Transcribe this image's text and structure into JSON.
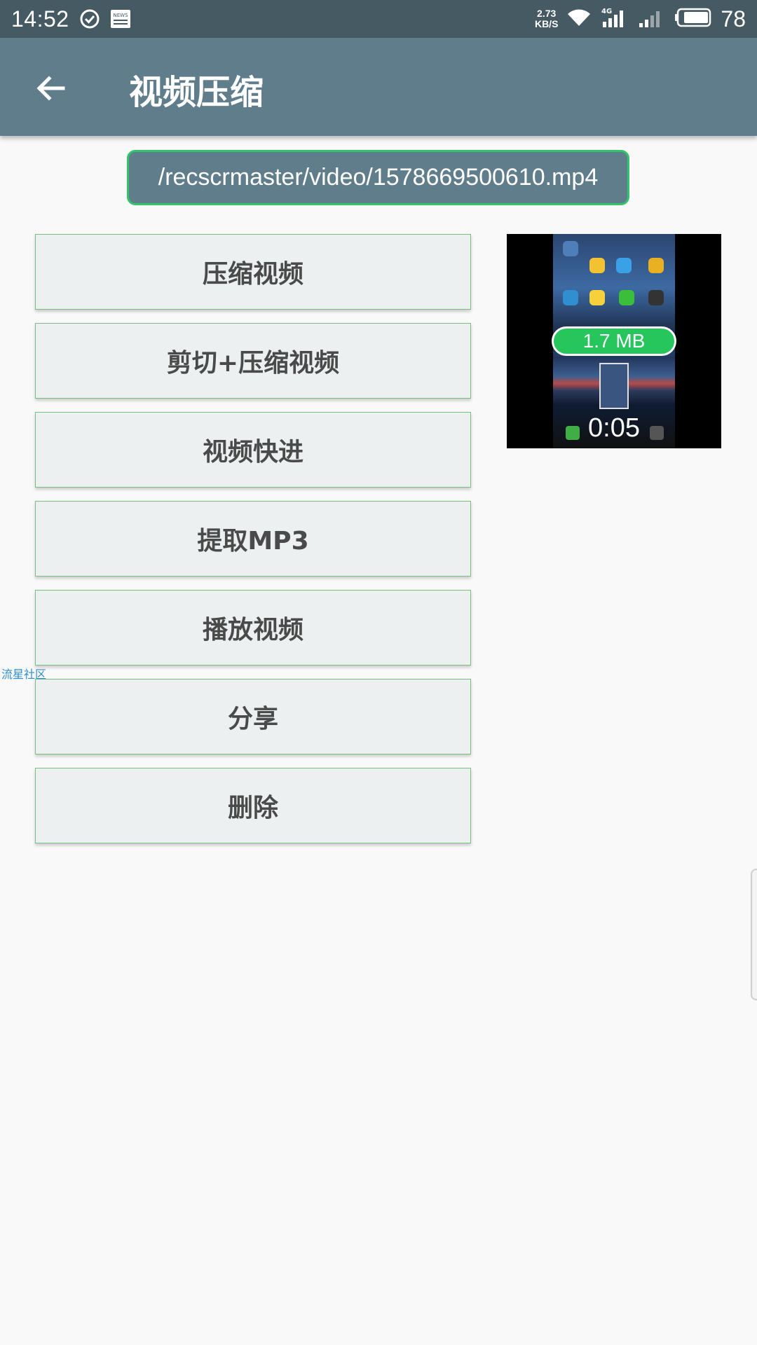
{
  "status_bar": {
    "time": "14:52",
    "net_speed_value": "2.73",
    "net_speed_unit": "KB/S",
    "network_type": "4G",
    "battery": "78",
    "news_icon_text": "NEWS"
  },
  "app_bar": {
    "title": "视频压缩",
    "back_icon": "arrow-back-icon"
  },
  "file_path": "/recscrmaster/video/1578669500610.mp4",
  "actions": [
    {
      "label": "压缩视频"
    },
    {
      "label": "剪切+压缩视频"
    },
    {
      "label": "视频快进"
    },
    {
      "label": "提取MP3"
    },
    {
      "label": "播放视频"
    },
    {
      "label": "分享"
    },
    {
      "label": "删除"
    }
  ],
  "thumbnail": {
    "size": "1.7 MB",
    "duration": "0:05"
  },
  "watermark": "流星社区",
  "colors": {
    "status_bar": "#465a64",
    "app_bar": "#607d8b",
    "accent_green": "#33c36b",
    "button_bg": "#ecf0f1",
    "button_border": "#7bbf7f"
  }
}
